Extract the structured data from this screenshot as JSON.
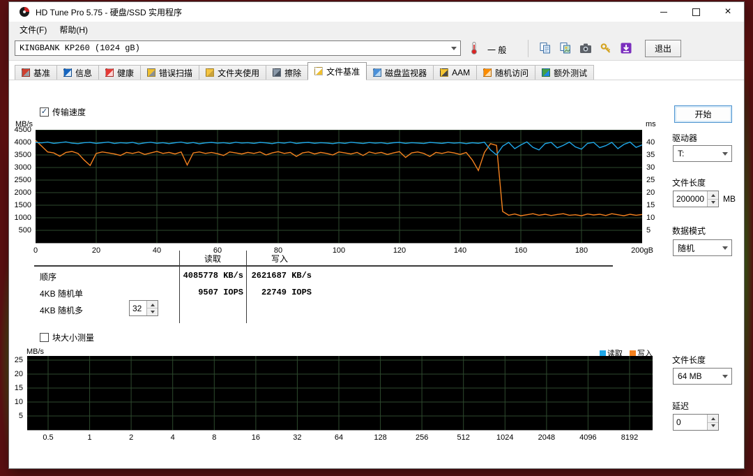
{
  "window": {
    "title": "HD Tune Pro 5.75 - 硬盘/SSD 实用程序"
  },
  "menu": {
    "items": [
      {
        "label": "文件(F)"
      },
      {
        "label": "帮助(H)"
      }
    ]
  },
  "toolbar": {
    "drive_selector_value": "KINGBANK KP260 (1024 gB)",
    "temp_icon": "thermometer-icon",
    "temperature_status": "一 般",
    "buttons": [
      "copy-text-icon",
      "copy-image-icon",
      "screenshot-icon",
      "license-key-icon",
      "save-results-icon"
    ],
    "exit_label": "退出"
  },
  "tabs": {
    "selected": "文件基准",
    "items": [
      {
        "id": "benchmark",
        "label": "基准",
        "icon": "benchmark-icon",
        "c1": "#d04030",
        "c2": "#9aa0a6"
      },
      {
        "id": "info",
        "label": "信息",
        "icon": "info-icon",
        "c1": "#1565c0",
        "c2": "#dcecfa"
      },
      {
        "id": "health",
        "label": "健康",
        "icon": "health-icon",
        "c1": "#e53935",
        "c2": "#ffd6d6"
      },
      {
        "id": "error-scan",
        "label": "错误扫描",
        "icon": "error-scan-icon",
        "c1": "#f0c030",
        "c2": "#8a9096"
      },
      {
        "id": "folder-usage",
        "label": "文件夹使用",
        "icon": "folder-icon",
        "c1": "#f5c542",
        "c2": "#caa23a"
      },
      {
        "id": "erase",
        "label": "擦除",
        "icon": "erase-icon",
        "c1": "#8a98a8",
        "c2": "#4a5664"
      },
      {
        "id": "file-benchmark",
        "label": "文件基准",
        "icon": "file-benchmark-icon",
        "c1": "#ffffff",
        "c2": "#f0c030"
      },
      {
        "id": "disk-monitor",
        "label": "磁盘监视器",
        "icon": "disk-monitor-icon",
        "c1": "#4a90d9",
        "c2": "#b8d8f2"
      },
      {
        "id": "aam",
        "label": "AAM",
        "icon": "speaker-icon",
        "c1": "#f4c430",
        "c2": "#4a4a4a"
      },
      {
        "id": "random-access",
        "label": "随机访问",
        "icon": "random-access-icon",
        "c1": "#fb8c00",
        "c2": "#ffe0b2"
      },
      {
        "id": "extra-tests",
        "label": "额外测试",
        "icon": "extra-tests-icon",
        "c1": "#43a047",
        "c2": "#1e88e5"
      }
    ]
  },
  "file_benchmark": {
    "transfer_speed_checkbox": {
      "label": "传输速度",
      "checked": true
    },
    "start_button": "开始",
    "drive": {
      "label": "驱动器",
      "value": "T:"
    },
    "file_length": {
      "label": "文件长度",
      "value": "200000",
      "unit": "MB"
    },
    "data_mode": {
      "label": "数据模式",
      "value": "随机"
    },
    "results": {
      "col_headers": [
        "读取",
        "写入"
      ],
      "rows": [
        {
          "label": "顺序",
          "read": "4085778 KB/s",
          "write": "2621687 KB/s"
        },
        {
          "label": "4KB 随机单",
          "read": "9507 IOPS",
          "write": "22749 IOPS"
        },
        {
          "label": "4KB 随机多",
          "read": "",
          "write": "",
          "queue_depth": "32"
        }
      ]
    },
    "block_size_checkbox": {
      "label": "块大小测量",
      "checked": false
    },
    "file_length2": {
      "label": "文件长度",
      "value": "64 MB"
    },
    "latency": {
      "label": "延迟",
      "value": "0"
    }
  },
  "chart_data": [
    {
      "type": "line",
      "title": "传输速度",
      "ylabel": "MB/s",
      "y2label": "ms",
      "xlabel": "gB",
      "xlim": [
        0,
        200
      ],
      "ylim": [
        0,
        4500
      ],
      "x_step": 2,
      "x_ticks": [
        0,
        20,
        40,
        60,
        80,
        100,
        120,
        140,
        160,
        180,
        200
      ],
      "x_tick_labels": [
        "0",
        "20",
        "40",
        "60",
        "80",
        "100",
        "120",
        "140",
        "160",
        "180",
        "200gB"
      ],
      "y_ticks": [
        500,
        1000,
        1500,
        2000,
        2500,
        3000,
        3500,
        4000,
        4500
      ],
      "y2_ticks": [
        5,
        10,
        15,
        20,
        25,
        30,
        35,
        40
      ],
      "y2_to_y1_factor": 100,
      "grid": true,
      "grid_color": "#2e4a2e",
      "background": "#000000",
      "legend_position": "none",
      "series": [
        {
          "name": "读取",
          "color": "#1fa7e8",
          "values": [
            4000,
            3980,
            4010,
            3960,
            3990,
            4020,
            3970,
            3950,
            3990,
            4000,
            3960,
            3985,
            4010,
            3955,
            3990,
            3970,
            4000,
            3940,
            3980,
            4005,
            3965,
            3990,
            3950,
            3985,
            4010,
            3960,
            3995,
            3945,
            3980,
            4000,
            3970,
            3990,
            3955,
            4005,
            3975,
            3990,
            3960,
            4000,
            3980,
            3950,
            3995,
            3970,
            4010,
            3955,
            3985,
            4000,
            3965,
            3990,
            3975,
            3950,
            3990,
            3960,
            4005,
            3980,
            3955,
            3995,
            3970,
            3990,
            3950,
            3985,
            4000,
            3960,
            3990,
            3975,
            3955,
            4000,
            3980,
            3960,
            3995,
            3970,
            3990,
            3950,
            3985,
            3965,
            4005,
            3700,
            3500,
            3850,
            4000,
            3750,
            3900,
            4020,
            3800,
            3700,
            3950,
            4000,
            3780,
            3880,
            4010,
            3820,
            3730,
            3960,
            4000,
            3790,
            3870,
            4000,
            3750,
            3920,
            4010,
            3800,
            3900
          ]
        },
        {
          "name": "写入",
          "color": "#f5821f",
          "values": [
            4080,
            3850,
            3620,
            3580,
            3450,
            3600,
            3640,
            3560,
            3300,
            3080,
            3560,
            3620,
            3580,
            3540,
            3480,
            3600,
            3560,
            3620,
            3520,
            3580,
            3640,
            3560,
            3600,
            3540,
            3620,
            3100,
            3580,
            3620,
            3560,
            3600,
            3550,
            3480,
            3620,
            3580,
            3540,
            3600,
            3560,
            3620,
            3500,
            3580,
            3630,
            3560,
            3600,
            3440,
            3580,
            3620,
            3540,
            3600,
            3560,
            3500,
            3620,
            3580,
            3540,
            3600,
            3480,
            3620,
            3560,
            3600,
            3520,
            3580,
            3630,
            3400,
            3580,
            3620,
            3560,
            3440,
            3600,
            3560,
            3620,
            3580,
            3520,
            3600,
            3300,
            2880,
            3600,
            3950,
            3880,
            1250,
            1100,
            1150,
            1080,
            1120,
            1160,
            1100,
            1140,
            1090,
            1130,
            1160,
            1100,
            1120,
            1080,
            1150,
            1110,
            1140,
            1090,
            1160,
            1120,
            1080,
            1140,
            1100,
            1130
          ]
        }
      ]
    },
    {
      "type": "line",
      "title": "块大小测量",
      "ylabel": "MB/s",
      "xlim": [
        0,
        14
      ],
      "ylim": [
        0,
        26.5
      ],
      "x_tick_labels": [
        "0.5",
        "1",
        "2",
        "4",
        "8",
        "16",
        "32",
        "64",
        "128",
        "256",
        "512",
        "1024",
        "2048",
        "4096",
        "8192"
      ],
      "y_ticks": [
        5,
        10,
        15,
        20,
        25
      ],
      "grid": true,
      "grid_color": "#2e4a2e",
      "background": "#000000",
      "legend_position": "top-right",
      "series": [
        {
          "name": "读取",
          "color": "#1fa7e8",
          "values": []
        },
        {
          "name": "写入",
          "color": "#f5821f",
          "values": []
        }
      ]
    }
  ]
}
